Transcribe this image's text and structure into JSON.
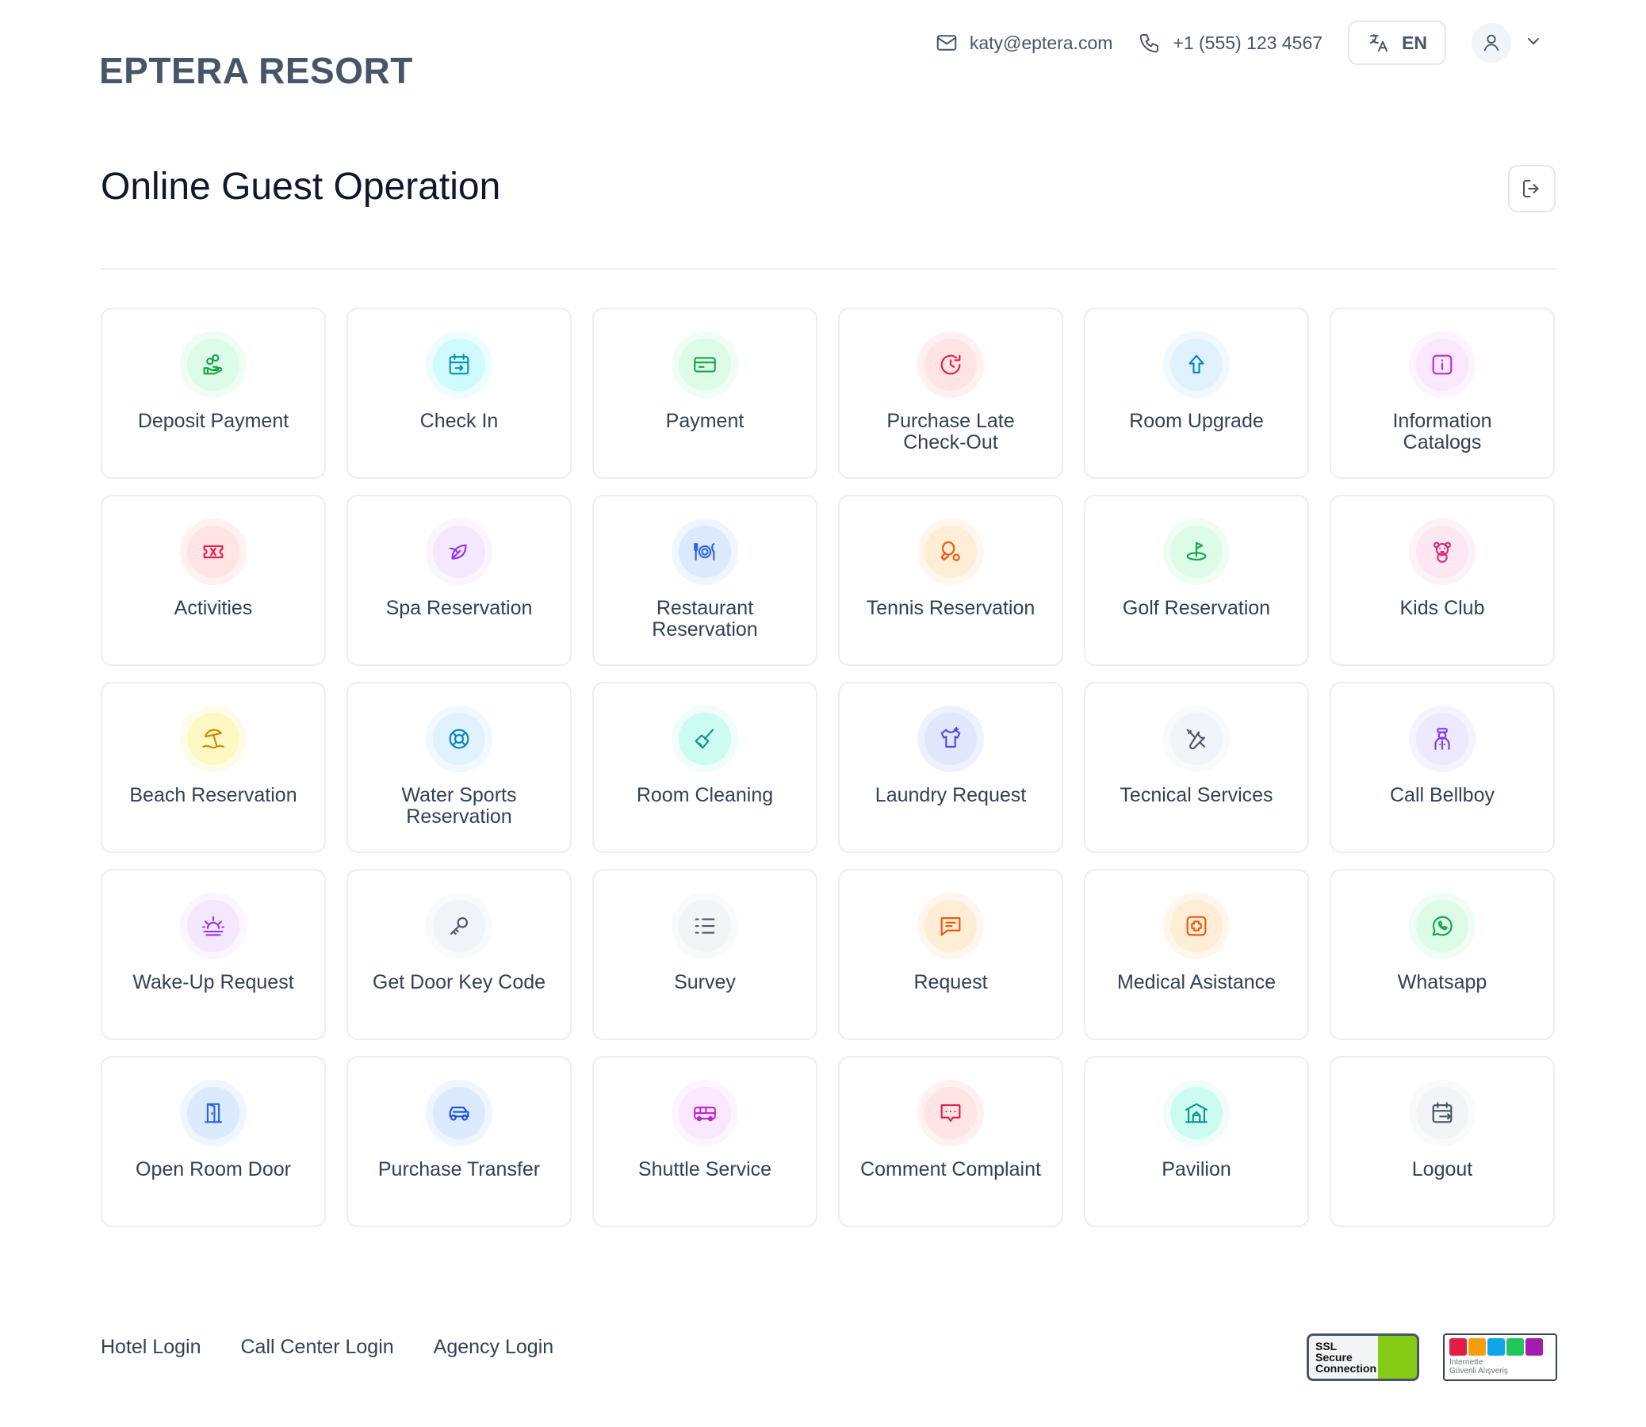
{
  "header": {
    "logo": "EPTERA RESORT",
    "email": "katy@eptera.com",
    "phone": "+1 (555) 123 4567",
    "language": "EN"
  },
  "page": {
    "title": "Online Guest Operation"
  },
  "services": [
    {
      "label": "Deposit Payment",
      "icon": "hand-coins-icon",
      "color": "#16a34a",
      "bg": "#dcfce7",
      "ring": "#f0fdf4"
    },
    {
      "label": "Check In",
      "icon": "calendar-check-in-icon",
      "color": "#0891b2",
      "bg": "#cffafe",
      "ring": "#ecfeff"
    },
    {
      "label": "Payment",
      "icon": "credit-card-icon",
      "color": "#16a34a",
      "bg": "#dcfce7",
      "ring": "#f0fdf4"
    },
    {
      "label": "Purchase Late Check-Out",
      "icon": "clock-refresh-icon",
      "color": "#e11d48",
      "bg": "#ffe4e6",
      "ring": "#fff1f2"
    },
    {
      "label": "Room Upgrade",
      "icon": "arrow-up-icon",
      "color": "#0284c7",
      "bg": "#e0f2fe",
      "ring": "#f0f9ff"
    },
    {
      "label": "Information Catalogs",
      "icon": "info-square-icon",
      "color": "#c026d3",
      "bg": "#fae8ff",
      "ring": "#fdf4ff"
    },
    {
      "label": "Activities",
      "icon": "ticket-icon",
      "color": "#e11d48",
      "bg": "#ffe4e6",
      "ring": "#fff1f2"
    },
    {
      "label": "Spa Reservation",
      "icon": "spa-leaf-icon",
      "color": "#9333ea",
      "bg": "#f3e8ff",
      "ring": "#faf5ff"
    },
    {
      "label": "Restaurant Reservation",
      "icon": "plate-cutlery-icon",
      "color": "#2563eb",
      "bg": "#dbeafe",
      "ring": "#eff6ff"
    },
    {
      "label": "Tennis Reservation",
      "icon": "tennis-racket-icon",
      "color": "#ea580c",
      "bg": "#ffedd5",
      "ring": "#fff7ed"
    },
    {
      "label": "Golf Reservation",
      "icon": "golf-icon",
      "color": "#16a34a",
      "bg": "#dcfce7",
      "ring": "#f0fdf4"
    },
    {
      "label": "Kids Club",
      "icon": "teddy-bear-icon",
      "color": "#db2777",
      "bg": "#fce7f3",
      "ring": "#fdf2f8"
    },
    {
      "label": "Beach Reservation",
      "icon": "beach-umbrella-icon",
      "color": "#ca8a04",
      "bg": "#fef9c3",
      "ring": "#fefce8"
    },
    {
      "label": "Water Sports Reservation",
      "icon": "lifebuoy-icon",
      "color": "#0284c7",
      "bg": "#e0f2fe",
      "ring": "#f0f9ff"
    },
    {
      "label": "Room Cleaning",
      "icon": "broom-icon",
      "color": "#0d9488",
      "bg": "#ccfbf1",
      "ring": "#f0fdfa"
    },
    {
      "label": "Laundry Request",
      "icon": "shirt-sparkle-icon",
      "color": "#4f46e5",
      "bg": "#e0e7ff",
      "ring": "#eef2ff"
    },
    {
      "label": "Tecnical Services",
      "icon": "tools-icon",
      "color": "#475569",
      "bg": "#f1f5f9",
      "ring": "#f8fafc"
    },
    {
      "label": "Call Bellboy",
      "icon": "bellboy-icon",
      "color": "#7c3aed",
      "bg": "#ede9fe",
      "ring": "#f5f3ff"
    },
    {
      "label": "Wake-Up Request",
      "icon": "sunrise-icon",
      "color": "#9333ea",
      "bg": "#f3e8ff",
      "ring": "#faf5ff"
    },
    {
      "label": "Get Door Key Code",
      "icon": "key-icon",
      "color": "#475569",
      "bg": "#f1f5f9",
      "ring": "#f8fafc"
    },
    {
      "label": "Survey",
      "icon": "checklist-icon",
      "color": "#475569",
      "bg": "#f3f4f6",
      "ring": "#f9fafb"
    },
    {
      "label": "Request",
      "icon": "message-text-icon",
      "color": "#ea580c",
      "bg": "#ffedd5",
      "ring": "#fff7ed"
    },
    {
      "label": "Medical Asistance",
      "icon": "medical-cross-icon",
      "color": "#ea580c",
      "bg": "#ffedd5",
      "ring": "#fff7ed"
    },
    {
      "label": "Whatsapp",
      "icon": "whatsapp-icon",
      "color": "#16a34a",
      "bg": "#dcfce7",
      "ring": "#f0fdf4"
    },
    {
      "label": "Open Room Door",
      "icon": "door-open-icon",
      "color": "#2563eb",
      "bg": "#dbeafe",
      "ring": "#eff6ff"
    },
    {
      "label": "Purchase Transfer",
      "icon": "car-icon",
      "color": "#1d4ed8",
      "bg": "#dbeafe",
      "ring": "#eff6ff"
    },
    {
      "label": "Shuttle Service",
      "icon": "bus-icon",
      "color": "#c026d3",
      "bg": "#fae8ff",
      "ring": "#fdf4ff"
    },
    {
      "label": "Comment Complaint",
      "icon": "message-dots-icon",
      "color": "#e11d48",
      "bg": "#ffe4e6",
      "ring": "#fff1f2"
    },
    {
      "label": "Pavilion",
      "icon": "pavilion-icon",
      "color": "#0d9488",
      "bg": "#ccfbf1",
      "ring": "#f0fdfa"
    },
    {
      "label": "Logout",
      "icon": "calendar-exit-icon",
      "color": "#475569",
      "bg": "#f3f4f6",
      "ring": "#f9fafb"
    }
  ],
  "footer": {
    "links": [
      "Hotel Login",
      "Call Center Login",
      "Agency Login"
    ],
    "ssl_badge": [
      "SSL",
      "Secure",
      "Connection"
    ],
    "guvenli_badge": [
      "Internette",
      "Güvenli Alışveriş"
    ]
  }
}
